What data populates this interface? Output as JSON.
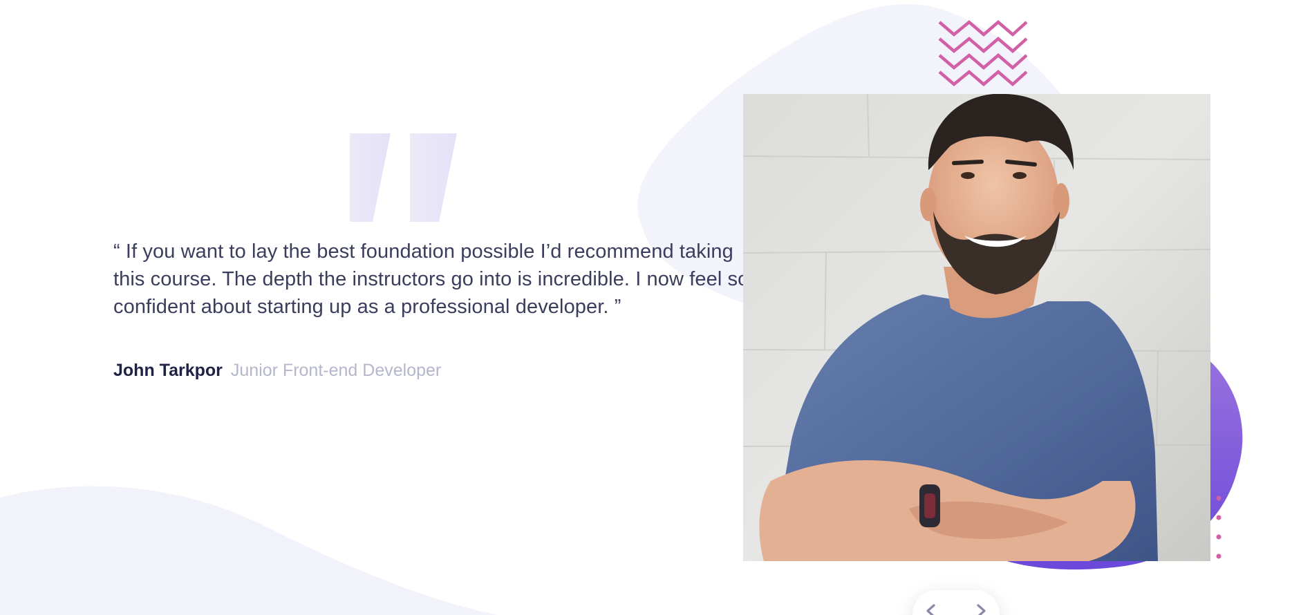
{
  "testimonial": {
    "quote": "“ If you want to lay the best foundation possible I’d recommend taking this course. The depth the instructors go into is incredible. I now feel so confident about starting up as a professional developer. ”",
    "author_name": "John Tarkpor",
    "author_role": "Junior Front-end Developer",
    "photo_subject": "smiling man with beard in blue t-shirt, arms crossed, white brick wall"
  },
  "icons": {
    "quote": "quote-icon",
    "prev": "chevron-left-icon",
    "next": "chevron-right-icon",
    "pattern": "zigzag-pattern-icon",
    "dots": "dots-pattern-icon"
  },
  "colors": {
    "text": "#3a3d5c",
    "heading": "#1f2145",
    "muted": "#b4b6cb",
    "bg_blob": "#f3f3fb",
    "accent_purple": "#7b5ce0",
    "accent_pink": "#d160a6",
    "nav_arrow": "#8a8aa8"
  }
}
